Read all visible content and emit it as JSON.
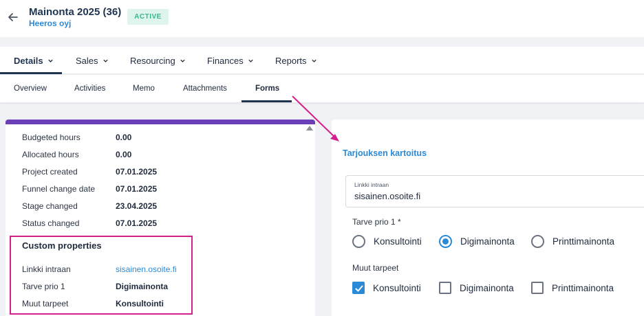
{
  "header": {
    "title": "Mainonta 2025 (36)",
    "subtitle": "Heeros oyj",
    "status": "ACTIVE",
    "back_icon": "arrow-left-icon"
  },
  "main_tabs": [
    {
      "label": "Details",
      "active": true
    },
    {
      "label": "Sales",
      "active": false
    },
    {
      "label": "Resourcing",
      "active": false
    },
    {
      "label": "Finances",
      "active": false
    },
    {
      "label": "Reports",
      "active": false
    }
  ],
  "sub_tabs": [
    {
      "label": "Overview",
      "active": false
    },
    {
      "label": "Activities",
      "active": false
    },
    {
      "label": "Memo",
      "active": false
    },
    {
      "label": "Attachments",
      "active": false
    },
    {
      "label": "Forms",
      "active": true
    }
  ],
  "details": [
    {
      "key": "Budgeted hours",
      "value": "0.00"
    },
    {
      "key": "Allocated hours",
      "value": "0.00"
    },
    {
      "key": "Project created",
      "value": "07.01.2025"
    },
    {
      "key": "Funnel change date",
      "value": "07.01.2025"
    },
    {
      "key": "Stage changed",
      "value": "23.04.2025"
    },
    {
      "key": "Status changed",
      "value": "07.01.2025"
    }
  ],
  "custom_properties": {
    "title": "Custom properties",
    "rows": [
      {
        "key": "Linkki intraan",
        "value": "sisainen.osoite.fi"
      },
      {
        "key": "Tarve prio 1",
        "value": "Digimainonta"
      },
      {
        "key": "Muut tarpeet",
        "value": "Konsultointi"
      }
    ]
  },
  "form": {
    "title": "Tarjouksen kartoitus",
    "link_field": {
      "label": "Linkki intraan",
      "value": "sisainen.osoite.fi"
    },
    "prio_question": "Tarve prio 1 *",
    "prio_options": [
      {
        "label": "Konsultointi",
        "selected": false
      },
      {
        "label": "Digimainonta",
        "selected": true
      },
      {
        "label": "Printtimainonta",
        "selected": false
      }
    ],
    "other_question": "Muut tarpeet",
    "other_options": [
      {
        "label": "Konsultointi",
        "checked": true
      },
      {
        "label": "Digimainonta",
        "checked": false
      },
      {
        "label": "Printtimainonta",
        "checked": false
      }
    ]
  },
  "colors": {
    "accent": "#2a8ad8",
    "navy": "#1e3450",
    "highlight": "#d4208f",
    "panel_bar": "#6a3fb5",
    "badge_bg": "#ddf5ec",
    "badge_text": "#3ab78f"
  }
}
